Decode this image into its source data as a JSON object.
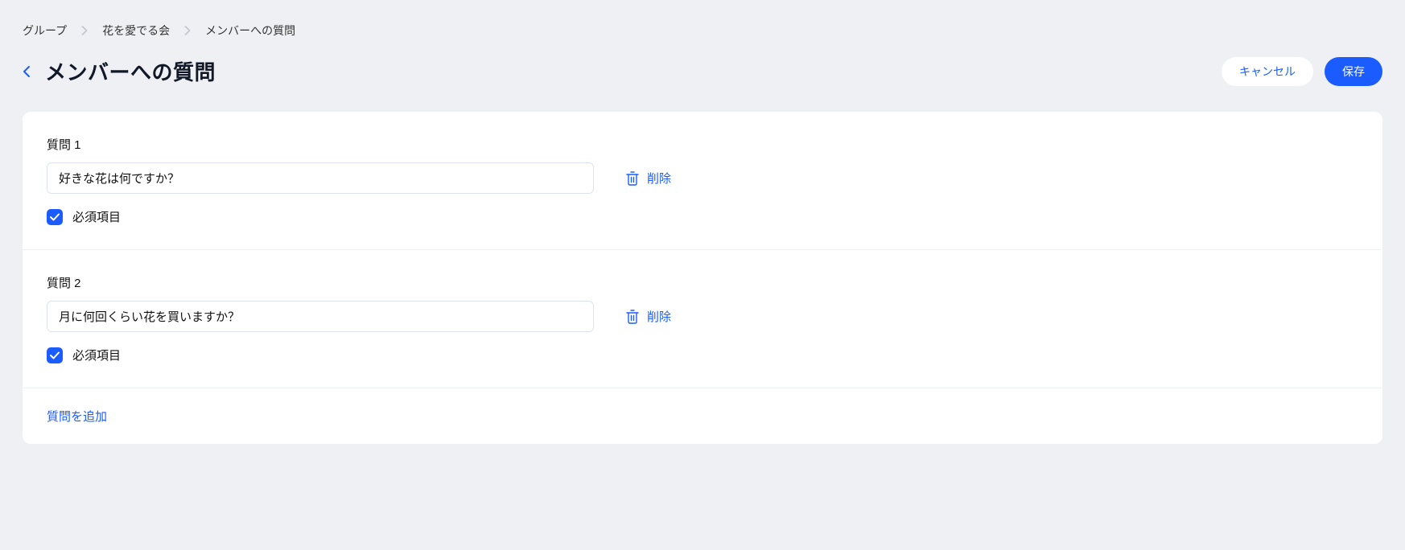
{
  "breadcrumb": {
    "items": [
      "グループ",
      "花を愛でる会",
      "メンバーへの質問"
    ]
  },
  "header": {
    "title": "メンバーへの質問",
    "cancel_label": "キャンセル",
    "save_label": "保存"
  },
  "questions": [
    {
      "label": "質問 1",
      "value": "好きな花は何ですか？",
      "delete_label": "削除",
      "required_label": "必須項目",
      "required_checked": true
    },
    {
      "label": "質問 2",
      "value": "月に何回くらい花を買いますか？",
      "delete_label": "削除",
      "required_label": "必須項目",
      "required_checked": true
    }
  ],
  "add_question_label": "質問を追加"
}
